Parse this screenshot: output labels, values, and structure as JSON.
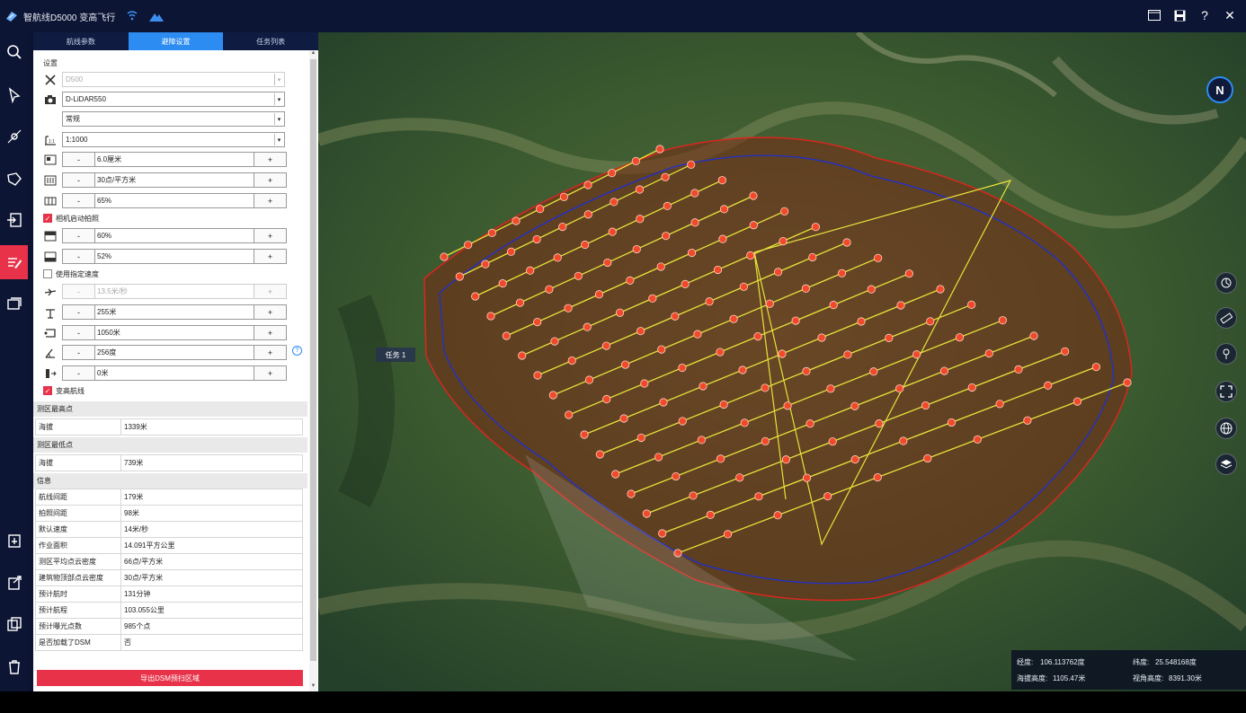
{
  "window": {
    "title": "智航线D5000 变高飞行",
    "icons": [
      "app-logo-icon",
      "wifi-icon",
      "mountain-icon"
    ],
    "buttons": [
      "window-icon",
      "save-icon",
      "help-icon",
      "close-icon"
    ],
    "help_glyph": "?",
    "close_glyph": "✕"
  },
  "left_toolbar": {
    "tools": [
      "search-icon",
      "select-icon",
      "point-icon",
      "polygon-icon",
      "import-icon",
      "route-edit-icon",
      "layer-window-icon",
      "add-task-icon",
      "export-icon",
      "copy-icon",
      "delete-icon"
    ],
    "active": "route-edit-icon"
  },
  "tabs": [
    {
      "label": "航线参数",
      "active": false
    },
    {
      "label": "避障设置",
      "active": true
    },
    {
      "label": "任务列表",
      "active": false
    }
  ],
  "settings": {
    "section_label": "设置",
    "aircraft": "D500",
    "sensor": "D-LiDAR550",
    "mode": "常规",
    "scale": "1:1000",
    "gsd": "6.0厘米",
    "point_density": "30点/平方米",
    "side_overlap": "65%",
    "camera_trigger_label": "相机启动拍照",
    "camera_trigger_checked": true,
    "forward_overlap": "60%",
    "lateral_overlap": "52%",
    "custom_speed_label": "使用指定速度",
    "custom_speed_checked": false,
    "speed": "13.5米/秒",
    "altitude": "255米",
    "route_length": "1050米",
    "heading": "256度",
    "extend": "0米",
    "variable_height_label": "变高航线",
    "variable_height_checked": true,
    "minus": "-",
    "plus": "+",
    "help": "?"
  },
  "highest_point": {
    "label": "测区最高点",
    "rows": [
      {
        "k": "海拔",
        "v": "1339米"
      }
    ]
  },
  "lowest_point": {
    "label": "测区最低点",
    "rows": [
      {
        "k": "海拔",
        "v": "739米"
      }
    ]
  },
  "info": {
    "label": "信息",
    "rows": [
      {
        "k": "航线间距",
        "v": "179米"
      },
      {
        "k": "拍照间距",
        "v": "98米"
      },
      {
        "k": "默认速度",
        "v": "14米/秒"
      },
      {
        "k": "作业面积",
        "v": "14.091平方公里"
      },
      {
        "k": "测区平均点云密度",
        "v": "66点/平方米"
      },
      {
        "k": "建筑物顶部点云密度",
        "v": "30点/平方米"
      },
      {
        "k": "预计航时",
        "v": "131分钟"
      },
      {
        "k": "预计航程",
        "v": "103.055公里"
      },
      {
        "k": "预计曝光点数",
        "v": "985个点"
      },
      {
        "k": "是否加载了DSM",
        "v": "否"
      }
    ]
  },
  "export_button": "导出DSM预扫区域",
  "map": {
    "task_label": "任务 1",
    "compass_label": "N",
    "right_tools": [
      "measure-icon",
      "ruler-icon",
      "location-icon",
      "fullscreen-icon",
      "globe-icon",
      "layers-icon"
    ],
    "coords": {
      "lon_label": "经度:",
      "lon": "106.113762度",
      "lat_label": "纬度:",
      "lat": "25.548168度",
      "alt_label": "海拔高度:",
      "alt": "1105.47米",
      "view_label": "视角高度:",
      "view": "8391.30米"
    },
    "colors": {
      "route": "#e8e23a",
      "boundary": "#d9261f",
      "waypoint": "#f04a2a",
      "border": "#1f2fd0"
    }
  }
}
